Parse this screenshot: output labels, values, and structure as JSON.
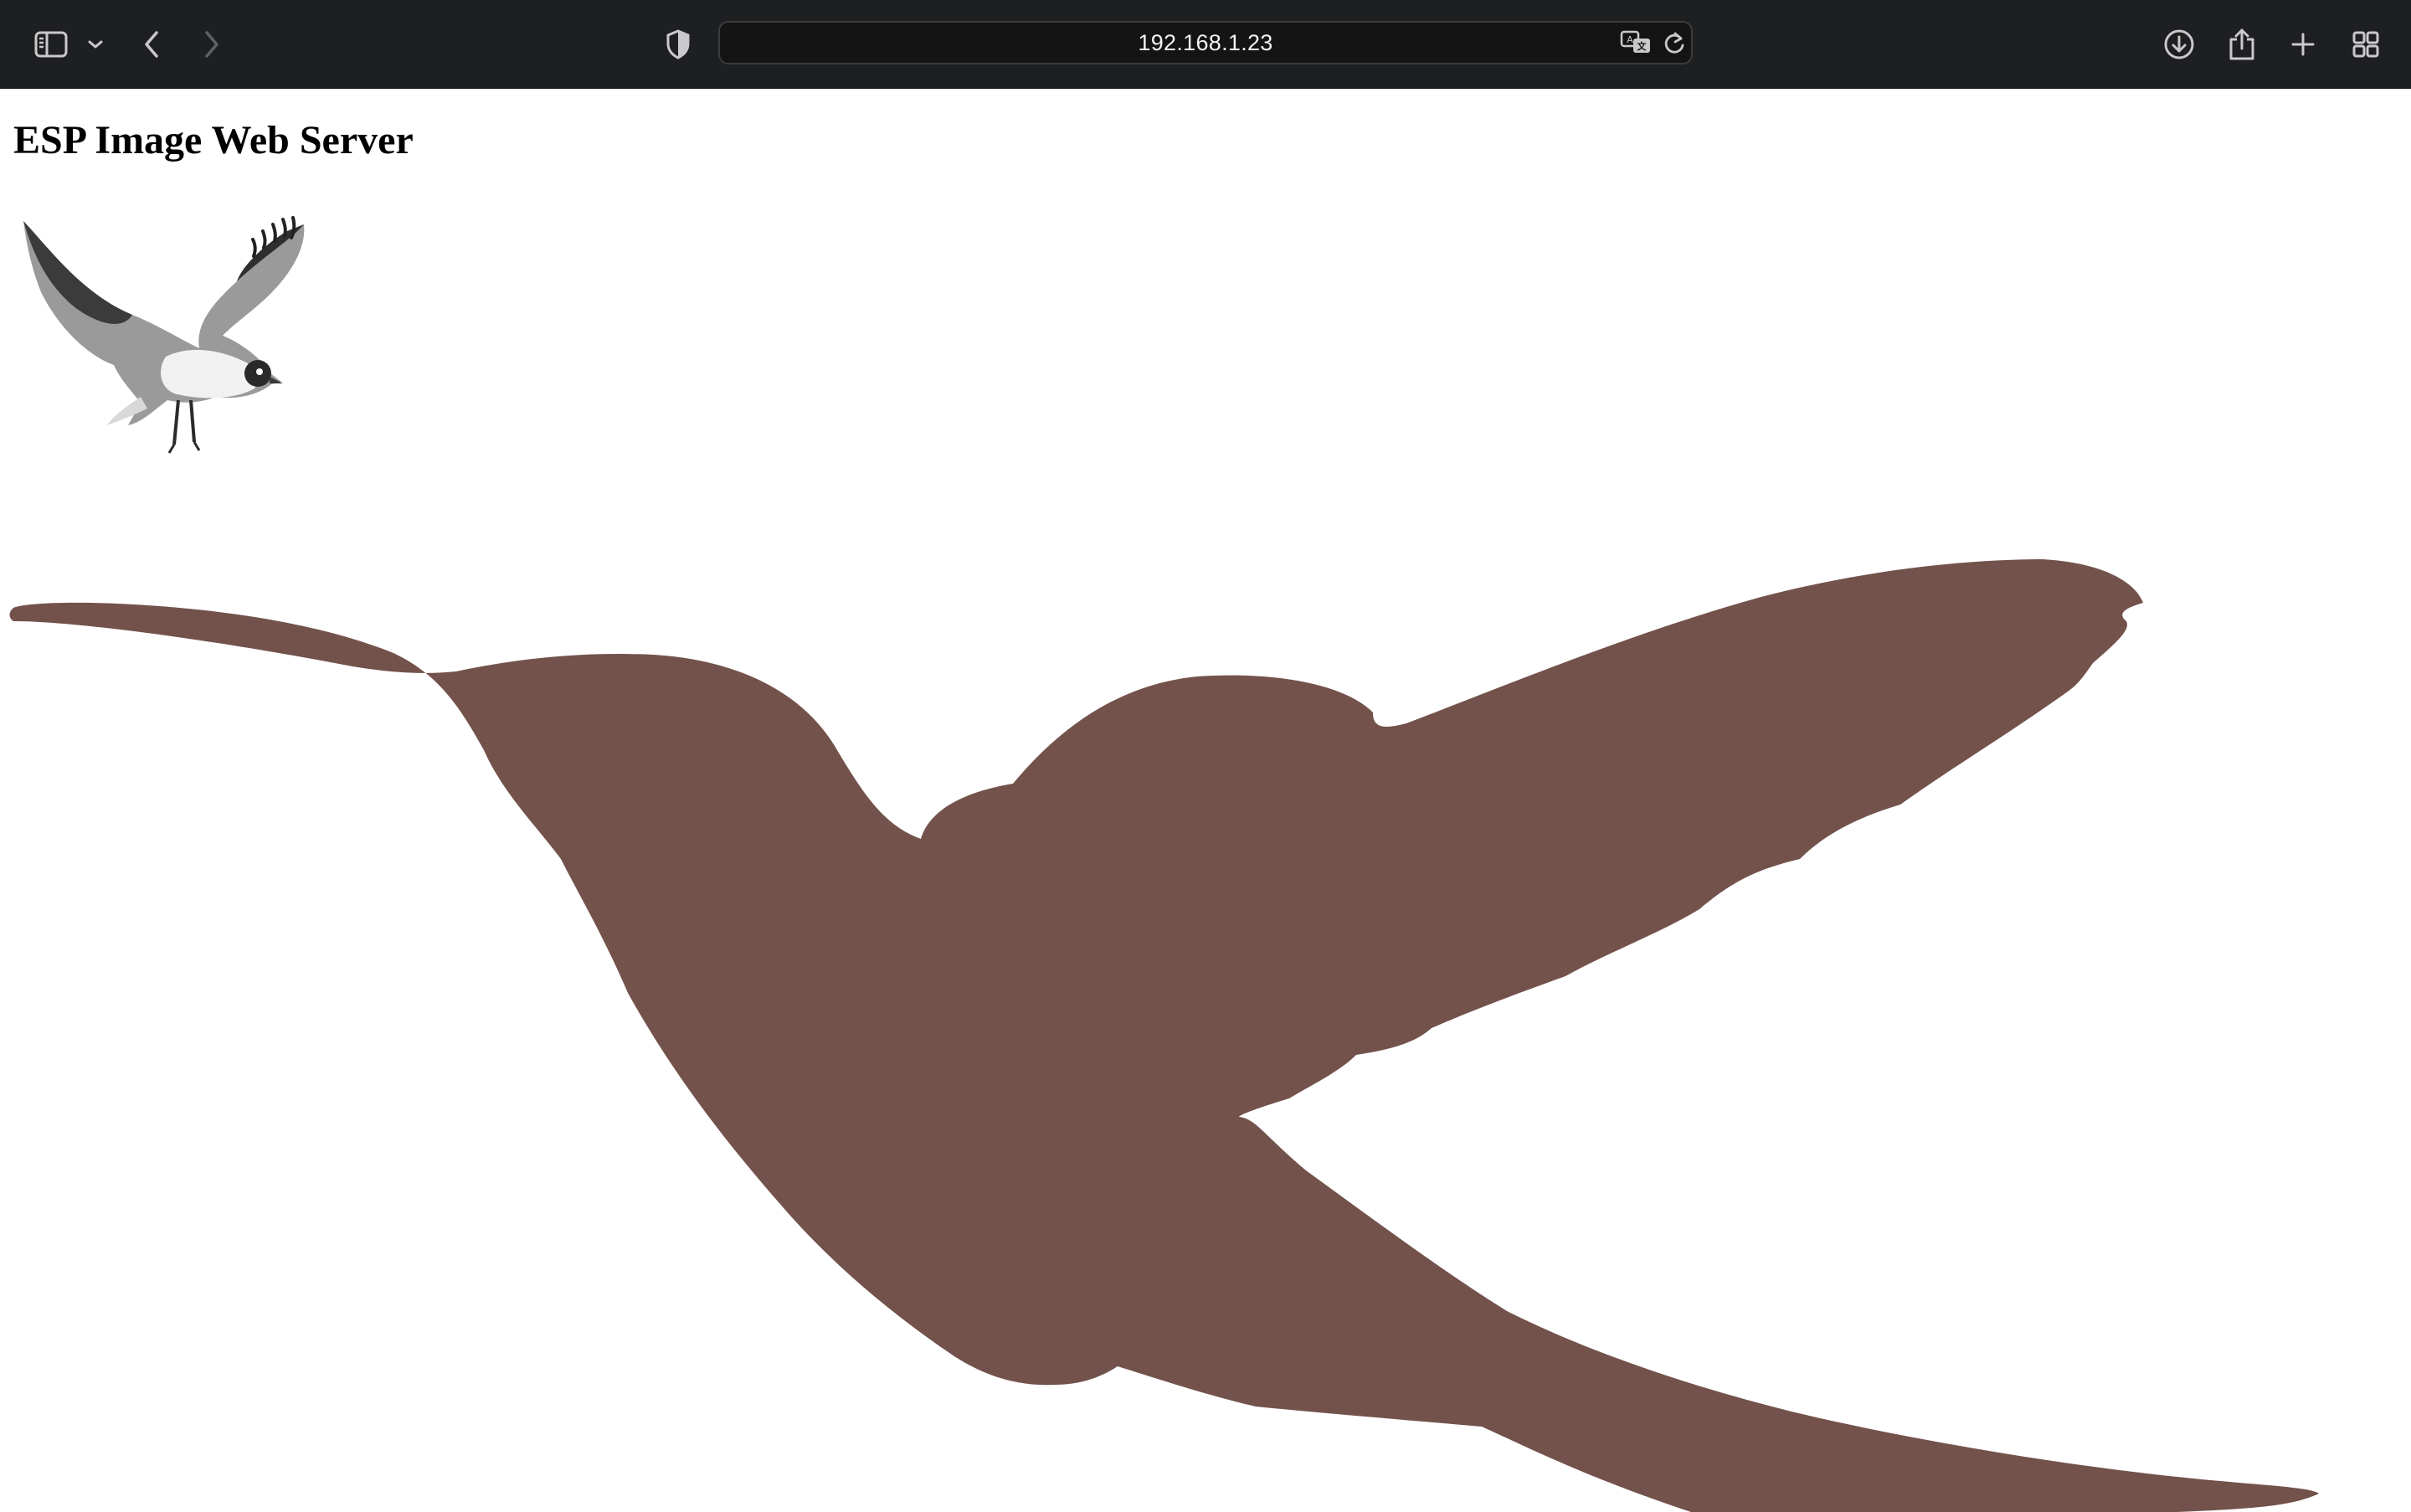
{
  "browser": {
    "address": "192.168.1.23",
    "icons": {
      "sidebar": "sidebar-icon",
      "sidebar_menu": "chevron-down-icon",
      "back": "chevron-left-icon",
      "forward": "chevron-right-icon",
      "privacy": "shield-icon",
      "translate": "translate-icon",
      "reload": "reload-icon",
      "downloads": "download-icon",
      "share": "share-icon",
      "new_tab": "plus-icon",
      "tab_overview": "tab-overview-icon"
    },
    "colors": {
      "toolbar": "#1e1f20",
      "address_bar": "#141415",
      "icon": "#c9c9cb",
      "icon_disabled": "#5f6063"
    }
  },
  "page": {
    "heading": "ESP Image Web Server",
    "images": [
      {
        "name": "seagull-image",
        "description_color": "#4a4a4a"
      },
      {
        "name": "hummingbird-silhouette-image",
        "fill": "#73524c"
      }
    ]
  }
}
